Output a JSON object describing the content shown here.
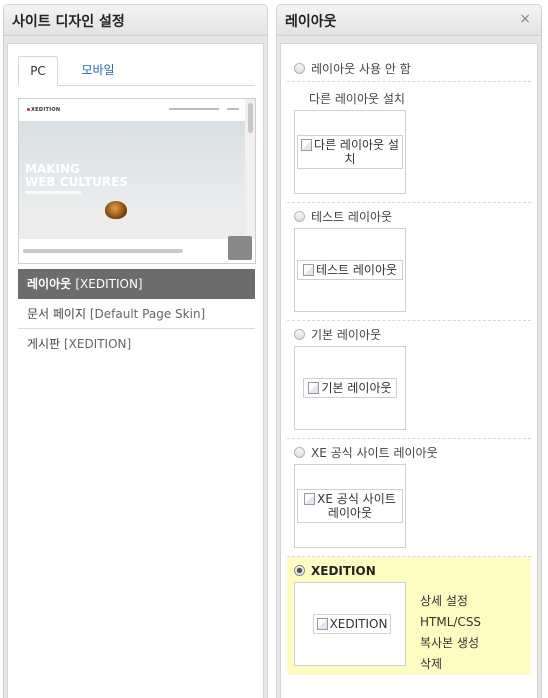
{
  "left_panel": {
    "title": "사이트 디자인 설정",
    "tabs": [
      {
        "label": "PC",
        "active": true
      },
      {
        "label": "모바일",
        "active": false
      }
    ],
    "preview": {
      "logo": "XEDITION",
      "hero_line1": "MAKING",
      "hero_line2": "WEB CULTURES"
    },
    "items": [
      {
        "label": "레이아웃",
        "detail": "[XEDITION]",
        "active": true
      },
      {
        "label": "문서 페이지",
        "detail": "[Default Page Skin]",
        "active": false
      },
      {
        "label": "게시판",
        "detail": "[XEDITION]",
        "active": false
      }
    ]
  },
  "right_panel": {
    "title": "레이아웃",
    "close_label": "×",
    "options": [
      {
        "label": "레이아웃 사용 안 함",
        "checked": false
      },
      {
        "label": "테스트 레이아웃",
        "checked": false,
        "image_alt": "테스트 레이아웃"
      },
      {
        "label": "기본 레이아웃",
        "checked": false,
        "image_alt": "기본 레이아웃"
      },
      {
        "label": "XE 공식 사이트 레이아웃",
        "checked": false,
        "image_alt": "XE 공식 사이트 레이아웃"
      },
      {
        "label": "XEDITION",
        "checked": true,
        "image_alt": "XEDITION"
      }
    ],
    "install_other": {
      "text": "다른 레이아웃 설치",
      "image_alt": "다른 레이아웃 설치"
    },
    "actions": [
      "상세 설정",
      "HTML/CSS",
      "복사본 생성",
      "삭제"
    ],
    "selected_bg_color": "#fffcc2"
  }
}
